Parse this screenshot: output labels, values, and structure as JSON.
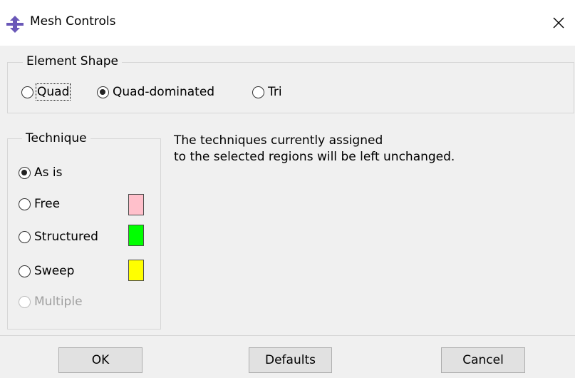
{
  "window": {
    "title": "Mesh Controls",
    "icon": "mesh-controls-app-icon",
    "close_icon": "close-icon"
  },
  "element_shape": {
    "label": "Element Shape",
    "options": [
      {
        "label": "Quad",
        "checked": false,
        "focused": true
      },
      {
        "label": "Quad-dominated",
        "checked": true
      },
      {
        "label": "Tri",
        "checked": false
      }
    ]
  },
  "technique": {
    "label": "Technique",
    "options": [
      {
        "label": "As is",
        "checked": true
      },
      {
        "label": "Free",
        "checked": false,
        "color": "#ffc0cb"
      },
      {
        "label": "Structured",
        "checked": false,
        "color": "#00ff00"
      },
      {
        "label": "Sweep",
        "checked": false,
        "color": "#ffff00"
      },
      {
        "label": "Multiple",
        "checked": false,
        "disabled": true
      }
    ],
    "description_line1": "The techniques currently assigned",
    "description_line2": "to the selected regions will be left unchanged."
  },
  "buttons": {
    "ok": "OK",
    "defaults": "Defaults",
    "cancel": "Cancel"
  }
}
